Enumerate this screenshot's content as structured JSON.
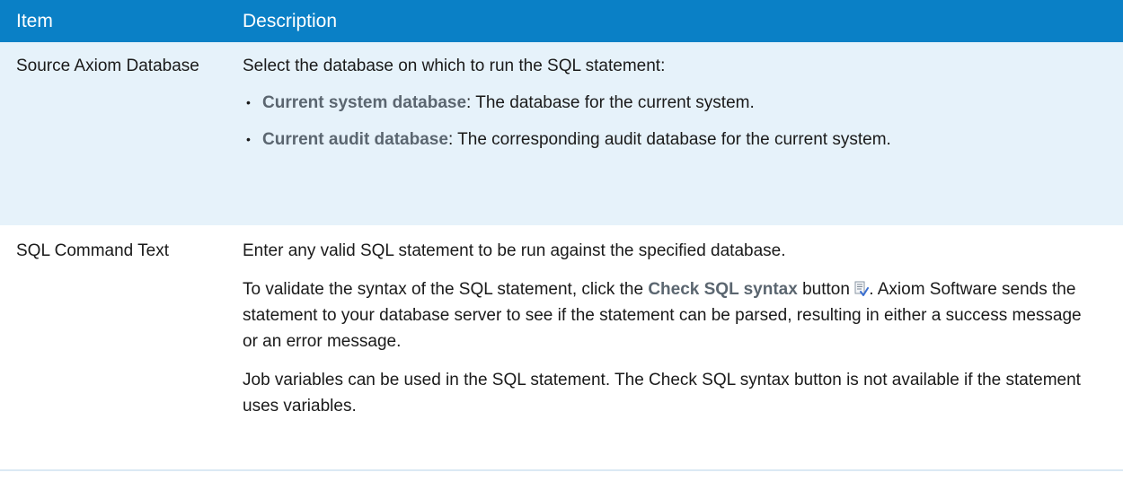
{
  "table": {
    "headers": [
      "Item",
      "Description"
    ],
    "rows": [
      {
        "item": "Source Axiom Database",
        "intro": "Select the database on which to run the SQL statement:",
        "options": [
          {
            "term": "Current system database",
            "text": ": The database for the current system."
          },
          {
            "term": "Current audit database",
            "text": ": The corresponding audit database for the current system."
          }
        ]
      },
      {
        "item": "SQL Command Text",
        "para1": "Enter any valid SQL statement to be run against the specified database.",
        "para2_before": "To validate the syntax of the SQL statement, click the ",
        "para2_term": "Check SQL syntax",
        "para2_mid": " button ",
        "para2_after": ". Axiom Software sends the statement to your database server to see if the statement can be parsed, resulting in either a success message or an error message.",
        "para3": "Job variables can be used in the SQL statement. The Check SQL syntax button is not available if the statement uses variables."
      }
    ]
  },
  "icons": {
    "check_sql_syntax": "check-sql-syntax-icon",
    "bullet": "•"
  },
  "colors": {
    "header_bg": "#0a80c6",
    "row_alt_bg": "#e6f2fa",
    "term_text": "#5b6670"
  }
}
